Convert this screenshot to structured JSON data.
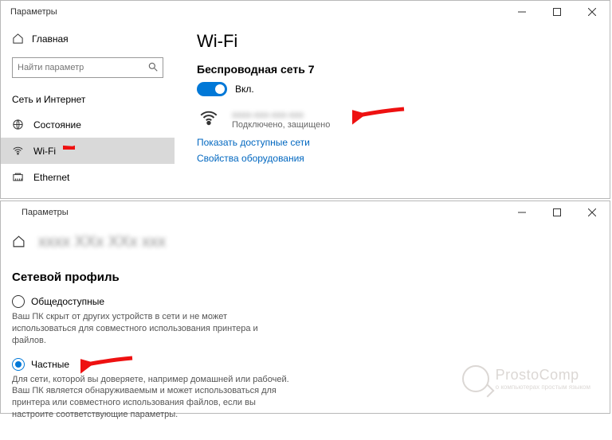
{
  "window1": {
    "title": "Параметры",
    "home": "Главная",
    "search_placeholder": "Найти параметр",
    "section": "Сеть и Интернет",
    "nav": [
      {
        "label": "Состояние"
      },
      {
        "label": "Wi-Fi"
      },
      {
        "label": "Ethernet"
      }
    ],
    "main": {
      "heading": "Wi-Fi",
      "net_name": "Беспроводная сеть 7",
      "toggle_label": "Вкл.",
      "ssid_blurred": "xxxx-xxx-xxx-xxx",
      "status": "Подключено, защищено",
      "link_show": "Показать доступные сети",
      "link_props": "Свойства оборудования"
    }
  },
  "window2": {
    "title": "Параметры",
    "ssid_blurred": "xxxx  XXx  XXx  xxx",
    "profile_heading": "Сетевой профиль",
    "radio_public": "Общедоступные",
    "public_desc": "Ваш ПК скрыт от других устройств в сети и не может использоваться для совместного использования принтера и файлов.",
    "radio_private": "Частные",
    "private_desc": "Для сети, которой вы доверяете, например домашней или рабочей. Ваш ПК является обнаруживаемым и может использоваться для принтера или совместного использования файлов, если вы настроите соответствующие параметры."
  },
  "watermark": {
    "title": "ProstoComp",
    "sub": "о компьютерах простым языком"
  }
}
